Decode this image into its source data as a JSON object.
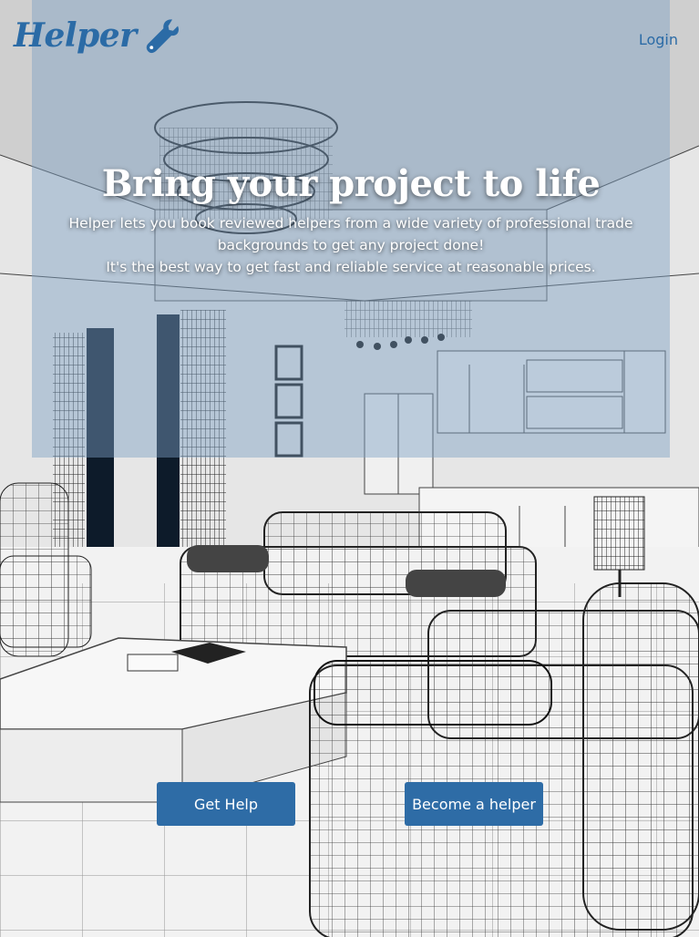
{
  "brand": {
    "name": "Helper",
    "icon": "wrench-icon",
    "color": "#2b6ba6"
  },
  "nav": {
    "login_label": "Login"
  },
  "hero": {
    "title": "Bring your project to life",
    "line1": "Helper lets you book reviewed helpers from a wide variety of professional trade",
    "line2": "backgrounds to get any project done!",
    "line3": "It's the best way to get fast and reliable service at reasonable prices."
  },
  "actions": {
    "get_help_label": "Get Help",
    "become_helper_label": "Become a helper"
  },
  "colors": {
    "accent": "#2e6ca6",
    "overlay": "#7da0c3"
  }
}
